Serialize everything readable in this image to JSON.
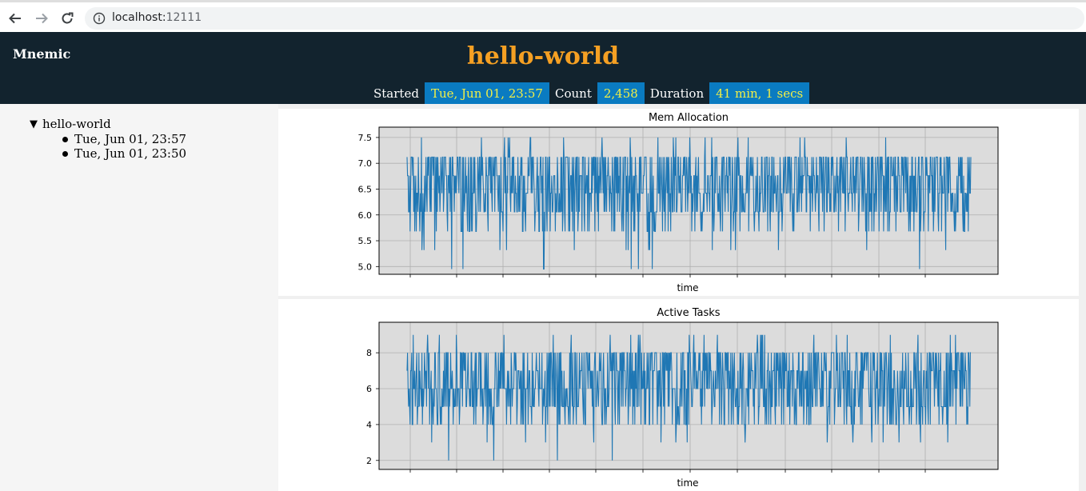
{
  "browser": {
    "url_host": "localhost:",
    "url_port": "12111"
  },
  "header": {
    "brand": "Mnemic",
    "title": "hello-world",
    "stats": [
      {
        "label": "Started",
        "value": "Tue, Jun 01, 23:57"
      },
      {
        "label": "Count",
        "value": "2,458"
      },
      {
        "label": "Duration",
        "value": "41 min, 1 secs"
      }
    ],
    "colors": {
      "bar": "#12232e",
      "title": "#f5a023",
      "value_bg": "#0a7bc1",
      "value_text": "#f1ee46"
    }
  },
  "sidebar": {
    "root": "hello-world",
    "runs": [
      "Tue, Jun 01, 23:57",
      "Tue, Jun 01, 23:50"
    ]
  },
  "chart_data": [
    {
      "type": "line",
      "title": "Mem Allocation",
      "xlabel": "time",
      "ylabel": "",
      "yticks": [
        "5.0",
        "5.5",
        "6.0",
        "6.5",
        "7.0",
        "7.5"
      ],
      "ylim": [
        4.95,
        7.55
      ],
      "levels": [
        4.95,
        5.32,
        5.68,
        6.06,
        6.42,
        6.76,
        7.12,
        7.5
      ],
      "base_level_range": [
        6.06,
        6.76
      ],
      "series": [
        {
          "color": "#1f77b4"
        }
      ],
      "grid": true,
      "x_ticks_labeled": false
    },
    {
      "type": "line",
      "title": "Active Tasks",
      "xlabel": "time",
      "ylabel": "",
      "yticks": [
        "2",
        "4",
        "6",
        "8"
      ],
      "ylim": [
        2,
        9
      ],
      "levels": [
        2,
        3,
        4,
        5,
        6,
        7,
        8,
        9
      ],
      "base_level_range": [
        5,
        7
      ],
      "series": [
        {
          "color": "#1f77b4"
        }
      ],
      "grid": true,
      "x_ticks_labeled": false
    }
  ]
}
